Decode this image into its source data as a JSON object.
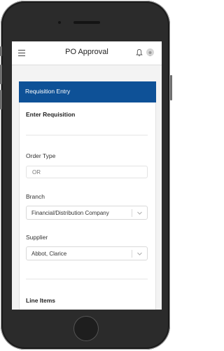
{
  "app": {
    "title": "PO Approval"
  },
  "icons": {
    "menu": "menu-icon",
    "bell": "bell-icon",
    "user": "user-icon",
    "dropdown": "chevron-down-icon"
  },
  "colors": {
    "header": "#0e5197",
    "background": "#f3f3f3"
  },
  "card": {
    "title": "Requisition Entry",
    "section_title": "Enter Requisition",
    "order_type": {
      "label": "Order Type",
      "value": "OR"
    },
    "branch": {
      "label": "Branch",
      "value": "Financial/Distribution Company"
    },
    "supplier": {
      "label": "Supplier",
      "value": "Abbot, Clarice"
    },
    "line_items_title": "Line Items"
  }
}
